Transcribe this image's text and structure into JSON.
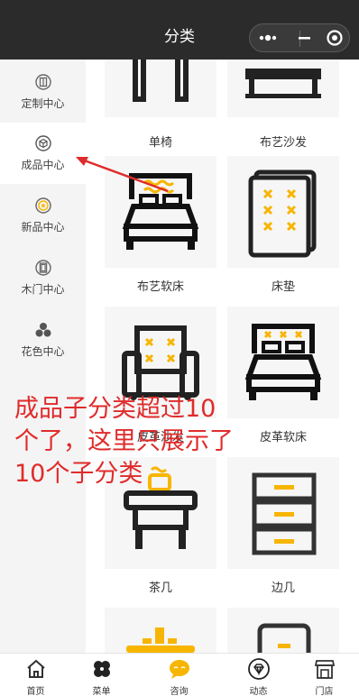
{
  "header": {
    "title": "分类"
  },
  "sidebar": {
    "items": [
      {
        "label": "定制中心",
        "icon": "customize-icon"
      },
      {
        "label": "成品中心",
        "icon": "cube-icon"
      },
      {
        "label": "新品中心",
        "icon": "new-star-icon"
      },
      {
        "label": "木门中心",
        "icon": "door-icon"
      },
      {
        "label": "花色中心",
        "icon": "color-swatch-icon"
      }
    ],
    "active_index": 1
  },
  "products": [
    {
      "name": "单椅",
      "icon": "chair-icon"
    },
    {
      "name": "布艺沙发",
      "icon": "fabric-sofa-icon"
    },
    {
      "name": "布艺软床",
      "icon": "fabric-bed-icon"
    },
    {
      "name": "床垫",
      "icon": "mattress-icon"
    },
    {
      "name": "皮革沙发",
      "icon": "leather-sofa-icon"
    },
    {
      "name": "皮革软床",
      "icon": "leather-bed-icon"
    },
    {
      "name": "茶几",
      "icon": "tea-table-icon"
    },
    {
      "name": "边几",
      "icon": "side-cabinet-icon"
    }
  ],
  "annotation": {
    "text": "成品子分类超过10个了，这里只展示了10个子分类"
  },
  "tabbar": {
    "items": [
      {
        "label": "首页",
        "icon": "home-icon"
      },
      {
        "label": "菜单",
        "icon": "menu-icon"
      },
      {
        "label": "咨询",
        "icon": "chat-icon"
      },
      {
        "label": "动态",
        "icon": "diamond-icon"
      },
      {
        "label": "门店",
        "icon": "store-icon"
      }
    ]
  },
  "colors": {
    "header_bg": "#2b2b2b",
    "accent": "#f7b500",
    "annotation": "#e02b2b",
    "sidebar_bg": "#f4f4f4"
  }
}
